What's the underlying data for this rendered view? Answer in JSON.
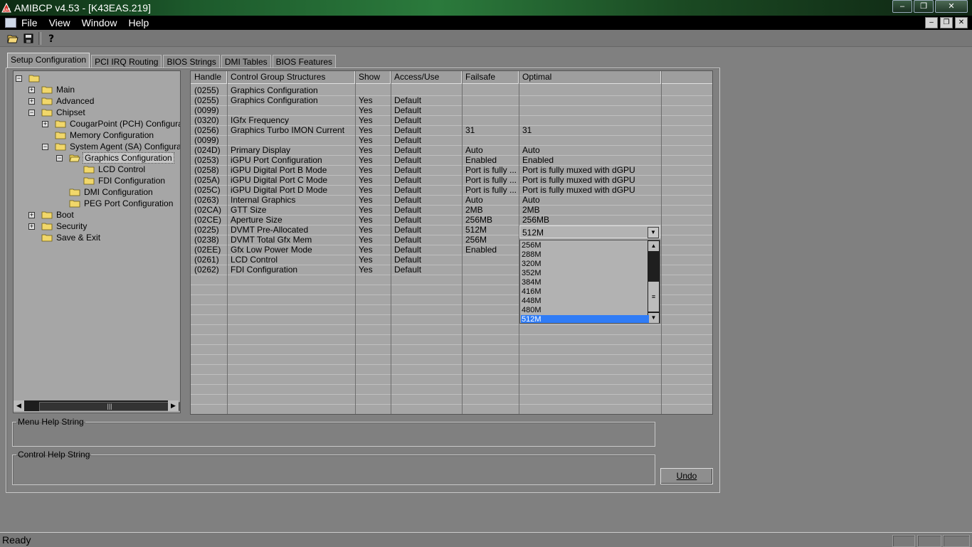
{
  "window": {
    "title": "AMIBCP v4.53 - [K43EAS.219]",
    "buttons": [
      "–",
      "❐",
      "✕"
    ]
  },
  "menubar": {
    "items": [
      "File",
      "View",
      "Window",
      "Help"
    ],
    "mdi_buttons": [
      "–",
      "❐",
      "✕"
    ]
  },
  "toolbar": {
    "icons": [
      "open-icon",
      "save-icon",
      "help-icon"
    ]
  },
  "tabs": [
    {
      "label": "Setup Configuration",
      "active": true
    },
    {
      "label": "PCI IRQ Routing",
      "active": false
    },
    {
      "label": "BIOS Strings",
      "active": false
    },
    {
      "label": "DMI Tables",
      "active": false
    },
    {
      "label": "BIOS Features",
      "active": false
    }
  ],
  "tree": [
    {
      "label": "",
      "depth": 0,
      "exp": "−"
    },
    {
      "label": "Main",
      "depth": 1,
      "exp": "+"
    },
    {
      "label": "Advanced",
      "depth": 1,
      "exp": "+"
    },
    {
      "label": "Chipset",
      "depth": 1,
      "exp": "−"
    },
    {
      "label": "CougarPoint (PCH) Configuration",
      "depth": 2,
      "exp": "+"
    },
    {
      "label": "Memory Configuration",
      "depth": 2,
      "exp": ""
    },
    {
      "label": "System Agent (SA) Configuration",
      "depth": 2,
      "exp": "−"
    },
    {
      "label": "Graphics Configuration",
      "depth": 3,
      "exp": "−",
      "selected": true,
      "open": true
    },
    {
      "label": "LCD Control",
      "depth": 4,
      "exp": ""
    },
    {
      "label": "FDI Configuration",
      "depth": 4,
      "exp": ""
    },
    {
      "label": "DMI Configuration",
      "depth": 3,
      "exp": ""
    },
    {
      "label": "PEG Port Configuration",
      "depth": 3,
      "exp": ""
    },
    {
      "label": "Boot",
      "depth": 1,
      "exp": "+"
    },
    {
      "label": "Security",
      "depth": 1,
      "exp": "+"
    },
    {
      "label": "Save & Exit",
      "depth": 1,
      "exp": ""
    }
  ],
  "grid": {
    "columns": [
      "Handle",
      "Control Group Structures",
      "Show",
      "Access/Use",
      "Failsafe",
      "Optimal"
    ],
    "rows": [
      [
        "(0255)",
        "Graphics Configuration",
        "",
        "",
        "",
        ""
      ],
      [
        "(0255)",
        "Graphics Configuration",
        "Yes",
        "Default",
        "",
        ""
      ],
      [
        "(0099)",
        "",
        "Yes",
        "Default",
        "",
        ""
      ],
      [
        "(0320)",
        "IGfx Frequency",
        "Yes",
        "Default",
        "",
        ""
      ],
      [
        "(0256)",
        "Graphics Turbo IMON Current",
        "Yes",
        "Default",
        "31",
        "31"
      ],
      [
        "(0099)",
        "",
        "Yes",
        "Default",
        "",
        ""
      ],
      [
        "(024D)",
        "Primary Display",
        "Yes",
        "Default",
        "Auto",
        "Auto"
      ],
      [
        "(0253)",
        "iGPU Port Configuration",
        "Yes",
        "Default",
        "Enabled",
        "Enabled"
      ],
      [
        "(0258)",
        "iGPU Digital Port B Mode",
        "Yes",
        "Default",
        "Port is fully ...",
        "Port is fully muxed with dGPU"
      ],
      [
        "(025A)",
        "iGPU Digital Port C Mode",
        "Yes",
        "Default",
        "Port is fully ...",
        "Port is fully muxed with dGPU"
      ],
      [
        "(025C)",
        "iGPU Digital Port D Mode",
        "Yes",
        "Default",
        "Port is fully ...",
        "Port is fully muxed with dGPU"
      ],
      [
        "(0263)",
        "Internal Graphics",
        "Yes",
        "Default",
        "Auto",
        "Auto"
      ],
      [
        "(02CA)",
        "GTT Size",
        "Yes",
        "Default",
        "2MB",
        "2MB"
      ],
      [
        "(02CE)",
        "Aperture Size",
        "Yes",
        "Default",
        "256MB",
        "256MB"
      ],
      [
        "(0225)",
        "DVMT Pre-Allocated",
        "Yes",
        "Default",
        "512M",
        ""
      ],
      [
        "(0238)",
        "DVMT Total Gfx Mem",
        "Yes",
        "Default",
        "256M",
        ""
      ],
      [
        "(02EE)",
        "Gfx Low Power Mode",
        "Yes",
        "Default",
        "Enabled",
        ""
      ],
      [
        "(0261)",
        "LCD Control",
        "Yes",
        "Default",
        "",
        ""
      ],
      [
        "(0262)",
        "FDI Configuration",
        "Yes",
        "Default",
        "",
        ""
      ]
    ],
    "empty_rows": 14
  },
  "combo": {
    "value": "512M",
    "options": [
      "256M",
      "288M",
      "320M",
      "352M",
      "384M",
      "416M",
      "448M",
      "480M",
      "512M"
    ],
    "selected_index": 8
  },
  "help": {
    "menu_label": "Menu Help String",
    "control_label": "Control Help String",
    "undo_label": "Undo"
  },
  "status": {
    "text": "Ready"
  }
}
